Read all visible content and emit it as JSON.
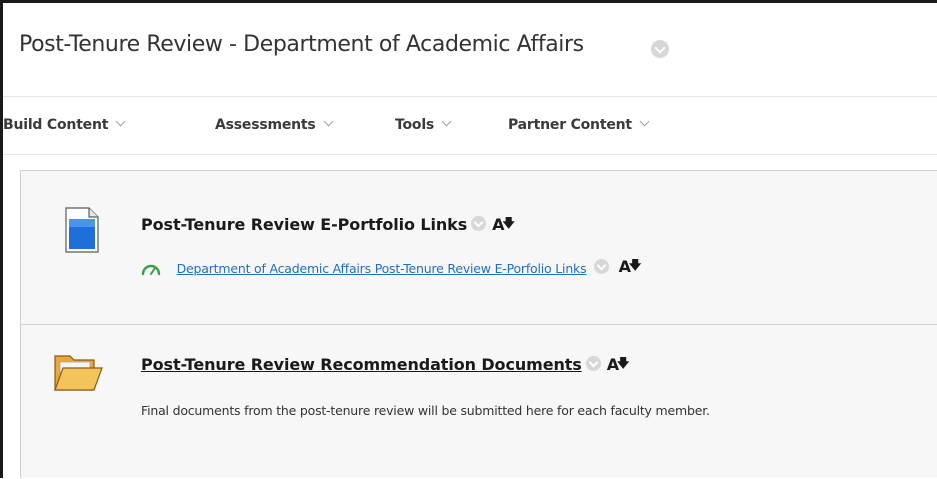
{
  "page": {
    "title": "Post-Tenure Review - Department of Academic Affairs",
    "title_menu_icon": "circle-chevron-down-icon"
  },
  "toolbar": {
    "items": [
      {
        "label": "Build Content"
      },
      {
        "label": "Assessments"
      },
      {
        "label": "Tools"
      },
      {
        "label": "Partner Content"
      }
    ]
  },
  "content": {
    "items": [
      {
        "type": "document",
        "icon": "document-icon",
        "title": "Post-Tenure Review E-Portfolio Links",
        "link": {
          "icon": "web-link-icon",
          "text": "Department of Academic Affairs Post-Tenure Review E-Porfolio Links"
        }
      },
      {
        "type": "folder",
        "icon": "folder-icon",
        "title": "Post-Tenure Review Recommendation Documents",
        "description": "Final documents from the post-tenure review will be submitted here for each faculty member."
      }
    ]
  },
  "colors": {
    "link": "#1f6fc5",
    "gauge_green": "#3aa047",
    "doc_blue": "#1e6fd9",
    "folder_yellow": "#f2c45a",
    "chevron_gray": "#d7d7d7"
  }
}
